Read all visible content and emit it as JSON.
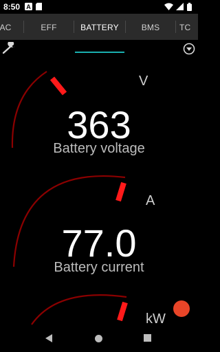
{
  "status_bar": {
    "time": "8:50",
    "icons": [
      "notification-a-icon",
      "sim-card-icon",
      "wifi-icon",
      "cellular-signal-icon",
      "battery-icon"
    ]
  },
  "tabs": [
    {
      "label": "AC",
      "active": false
    },
    {
      "label": "EFF",
      "active": false
    },
    {
      "label": "BATTERY",
      "active": true
    },
    {
      "label": "BMS",
      "active": false
    },
    {
      "label": "TC",
      "active": false
    }
  ],
  "toolbar": {
    "settings_icon": "wrench-icon",
    "menu_icon": "dropdown-circle-icon"
  },
  "gauges": [
    {
      "value": "363",
      "label": "Battery voltage",
      "unit": "V"
    },
    {
      "value": "77.0",
      "label": "Battery current",
      "unit": "A"
    },
    {
      "value": "",
      "label": "",
      "unit": "kW"
    }
  ],
  "colors": {
    "accent_tab": "#1ab0b0",
    "gauge_arc": "#8b0000",
    "gauge_needle": "#ff1a1a",
    "fab": "#e84528"
  }
}
